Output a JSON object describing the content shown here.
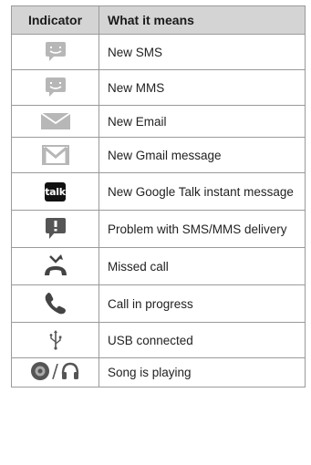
{
  "header": {
    "indicator": "Indicator",
    "meaning": "What it means"
  },
  "rows": [
    {
      "icon": "sms-icon",
      "text": "New SMS"
    },
    {
      "icon": "mms-icon",
      "text": "New MMS"
    },
    {
      "icon": "email-icon",
      "text": "New Email"
    },
    {
      "icon": "gmail-icon",
      "text": "New Gmail message"
    },
    {
      "icon": "talk-icon",
      "icon_text": "talk",
      "text": "New Google Talk instant message"
    },
    {
      "icon": "sms-error-icon",
      "text": "Problem with SMS/MMS delivery"
    },
    {
      "icon": "missed-call-icon",
      "text": "Missed call"
    },
    {
      "icon": "call-in-progress-icon",
      "text": "Call in progress"
    },
    {
      "icon": "usb-icon",
      "text": "USB connected"
    },
    {
      "icon": "music-icon",
      "icon_sep": "/",
      "text": "Song is playing"
    }
  ],
  "colors": {
    "header_bg": "#d4d4d4",
    "border": "#9a9a9a",
    "icon_gray": "#b7b7b7",
    "icon_dark": "#4a4a4a"
  }
}
